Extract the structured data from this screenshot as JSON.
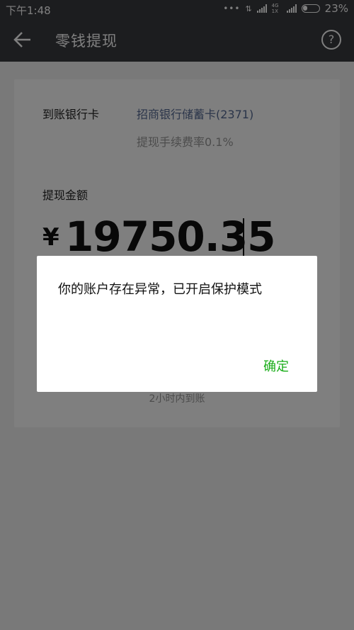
{
  "status_bar": {
    "time": "下午1:48",
    "network": "4G 1X",
    "battery": "23%"
  },
  "nav": {
    "title": "零钱提现",
    "back_icon": "arrow-left-icon",
    "help_icon": "question-circle-icon",
    "help_glyph": "?"
  },
  "form": {
    "bank_label": "到账银行卡",
    "bank_name": "招商银行储蓄卡(2371)",
    "fee_rate": "提现手续费率0.1%",
    "amount_label": "提现金额",
    "currency_symbol": "¥",
    "amount": "19750.35",
    "arrival_time": "2小时内到账"
  },
  "dialog": {
    "message": "你的账户存在异常，已开启保护模式",
    "confirm_label": "确定"
  },
  "colors": {
    "nav_bg": "#393a3f",
    "link": "#576b95",
    "confirm": "#1aad19"
  }
}
